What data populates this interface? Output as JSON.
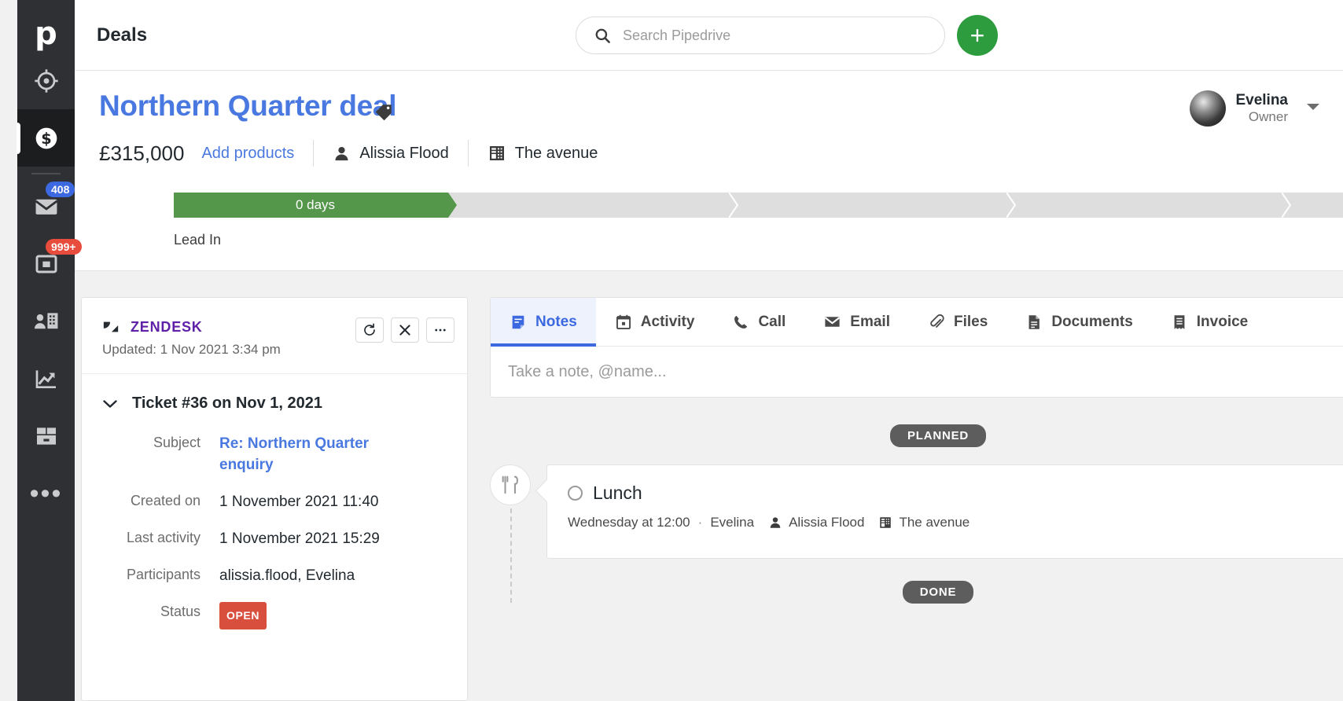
{
  "rail": {
    "logo": "p",
    "items": [
      {
        "name": "leads-inbox",
        "icon": "target-icon",
        "badge": null,
        "active": false
      },
      {
        "name": "deals",
        "icon": "dollar-circle-icon",
        "badge": null,
        "active": true
      },
      {
        "name": "mail",
        "icon": "envelope-icon",
        "badge": "408",
        "badge_color": "#3c68e0",
        "active": false
      },
      {
        "name": "campaigns",
        "icon": "campaign-icon",
        "badge": "999+",
        "badge_color": "#e74c3c",
        "active": false
      },
      {
        "name": "contacts",
        "icon": "contacts-icon",
        "badge": null,
        "active": false
      },
      {
        "name": "insights",
        "icon": "trend-up-icon",
        "badge": null,
        "active": false
      },
      {
        "name": "products",
        "icon": "box-icon",
        "badge": null,
        "active": false
      },
      {
        "name": "more",
        "icon": "ellipsis-icon",
        "badge": null,
        "active": false
      }
    ]
  },
  "topbar": {
    "title": "Deals",
    "search": {
      "placeholder": "Search Pipedrive",
      "value": ""
    },
    "add_label": "+"
  },
  "deal": {
    "title": "Northern Quarter deal",
    "value": "£315,000",
    "add_products_label": "Add products",
    "person": "Alissia Flood",
    "organization": "The avenue",
    "owner": {
      "name": "Evelina",
      "role": "Owner"
    },
    "pipeline": {
      "current_stage_label": "Lead In",
      "days_in_stage": "0 days",
      "stages_total": 5,
      "completed_stages": 1
    }
  },
  "zendesk": {
    "brand": "ZENDESK",
    "updated": "Updated: 1 Nov 2021 3:34 pm",
    "actions": [
      {
        "name": "refresh-button",
        "icon": "refresh-icon"
      },
      {
        "name": "unlink-button",
        "icon": "unlink-icon"
      },
      {
        "name": "more-options-button",
        "icon": "ellipsis-icon"
      }
    ],
    "ticket_title": "Ticket #36 on Nov 1, 2021",
    "fields": [
      {
        "label": "Subject",
        "value": "Re: Northern Quarter enquiry",
        "type": "link"
      },
      {
        "label": "Created on",
        "value": "1 November 2021 11:40",
        "type": "text"
      },
      {
        "label": "Last activity",
        "value": "1 November 2021 15:29",
        "type": "text"
      },
      {
        "label": "Participants",
        "value": "alissia.flood, Evelina",
        "type": "text"
      },
      {
        "label": "Status",
        "value": "OPEN",
        "type": "badge"
      }
    ]
  },
  "detail_tabs": [
    {
      "label": "Notes",
      "icon": "note-icon",
      "active": true
    },
    {
      "label": "Activity",
      "icon": "calendar-icon",
      "active": false
    },
    {
      "label": "Call",
      "icon": "phone-icon",
      "active": false
    },
    {
      "label": "Email",
      "icon": "envelope-icon",
      "active": false
    },
    {
      "label": "Files",
      "icon": "paperclip-icon",
      "active": false
    },
    {
      "label": "Documents",
      "icon": "document-icon",
      "active": false
    },
    {
      "label": "Invoice",
      "icon": "invoice-icon",
      "active": false
    }
  ],
  "note_input": {
    "placeholder": "Take a note, @name...",
    "value": ""
  },
  "timeline": {
    "planned_label": "PLANNED",
    "done_label": "DONE",
    "activity": {
      "title": "Lunch",
      "icon": "lunch-icon",
      "when": "Wednesday at 12:00",
      "separator": "·",
      "owner": "Evelina",
      "person": "Alissia Flood",
      "organization": "The avenue"
    }
  },
  "colors": {
    "brand_blue": "#4979e0",
    "accent_green": "#2c9c3e",
    "stage_green": "#54964a",
    "status_red": "#d94f3d",
    "zendesk_purple": "#5f21a8",
    "rail_dark": "#2e3033"
  }
}
